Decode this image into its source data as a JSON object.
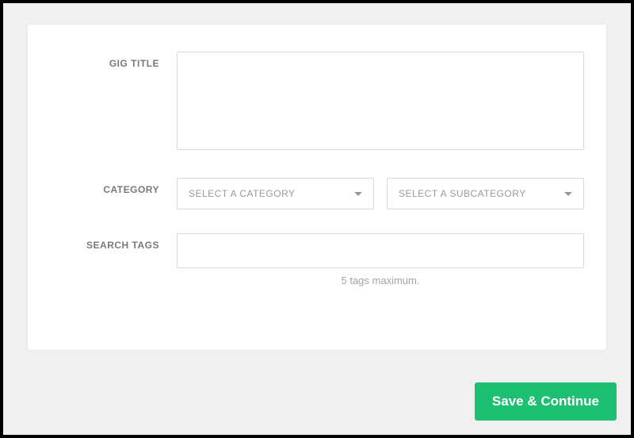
{
  "form": {
    "gig_title": {
      "label": "GIG TITLE",
      "value": ""
    },
    "category": {
      "label": "CATEGORY",
      "main_placeholder": "SELECT A CATEGORY",
      "sub_placeholder": "SELECT A SUBCATEGORY"
    },
    "search_tags": {
      "label": "SEARCH TAGS",
      "value": "",
      "hint": "5 tags maximum."
    }
  },
  "actions": {
    "save_continue": "Save & Continue"
  },
  "colors": {
    "primary": "#1dbf73",
    "border": "#d8d8d8",
    "label": "#7a7a7a",
    "placeholder": "#9a9a9a"
  }
}
